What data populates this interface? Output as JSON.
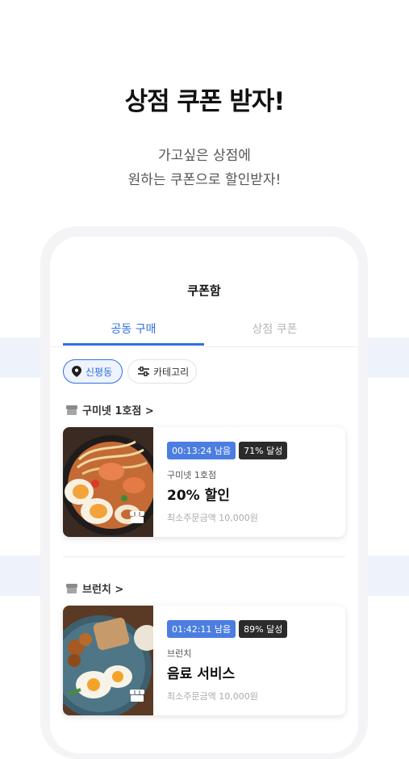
{
  "hero": {
    "title": "상점 쿠폰 받자!",
    "subtitle_line1": "가고싶은 상점에",
    "subtitle_line2": "원하는 쿠폰으로 할인받자!"
  },
  "app": {
    "title": "쿠폰함",
    "tabs": [
      {
        "label": "공동 구매",
        "active": true
      },
      {
        "label": "상점 쿠폰",
        "active": false
      }
    ],
    "filters": {
      "location": "신평동",
      "category": "카테고리"
    },
    "sections": [
      {
        "store_header": "구미넷 1호점 >",
        "coupon": {
          "time_left": "00:13:24 남음",
          "achievement": "71% 달성",
          "store": "구미넷 1호점",
          "title": "20% 할인",
          "min_order": "최소주문금액 10,000원"
        }
      },
      {
        "store_header": "브런치 >",
        "coupon": {
          "time_left": "01:42:11 남음",
          "achievement": "89% 달성",
          "store": "브런치",
          "title": "음료 서비스",
          "min_order": "최소주문금액 10,000원"
        }
      }
    ]
  },
  "colors": {
    "accent": "#2f6fe0",
    "band": "#eef3fb",
    "time_badge": "#4b7ee0",
    "rate_badge": "#2b2b2b"
  }
}
